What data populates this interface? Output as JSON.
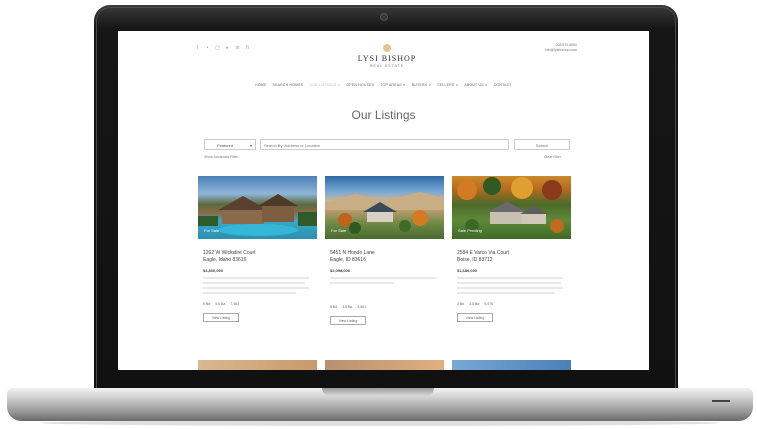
{
  "brand": {
    "name": "LYSI BISHOP",
    "tagline": "REAL ESTATE"
  },
  "contact": {
    "phone": "208.870.8000",
    "email": "info@lysibishop.com"
  },
  "social_icons": [
    "facebook-icon",
    "twitter-icon",
    "instagram-icon",
    "youtube-icon",
    "linkedin-icon",
    "houzz-icon"
  ],
  "nav": {
    "items": [
      {
        "label": "HOME"
      },
      {
        "label": "SEARCH HOMES"
      },
      {
        "label": "OUR LISTINGS ∨"
      },
      {
        "label": "OPEN HOUSES"
      },
      {
        "label": "TOP AREAS ∨"
      },
      {
        "label": "BUYERS ∨"
      },
      {
        "label": "SELLERS ∨"
      },
      {
        "label": "ABOUT US ∨"
      },
      {
        "label": "CONTACT"
      }
    ]
  },
  "page": {
    "title": "Our Listings"
  },
  "filter": {
    "sort_value": "Featured",
    "search_placeholder": "Search By: Address or Location",
    "search_button": "Search",
    "advanced_link": "Show Advanced Filter",
    "clear_link": "Clear Filter"
  },
  "listings": [
    {
      "status": "For Sale",
      "address_line1": "1262 W Wickstire Court",
      "address_line2": "Eagle, Idaho 83616",
      "price": "$3,800,000",
      "beds": "5 Bd",
      "baths": "5.5 Ba",
      "sqft": "7,463",
      "button": "View Listing"
    },
    {
      "status": "For Sale",
      "address_line1": "5451 N Hondo Lane",
      "address_line2": "Eagle, ID 83616",
      "price": "$2,098,000",
      "beds": "5 Bd",
      "baths": "3.5 Ba",
      "sqft": "3,961",
      "button": "View Listing"
    },
    {
      "status": "Sale Pending",
      "address_line1": "2584 E Varco Via Court",
      "address_line2": "Boise, ID 83712",
      "price": "$1,680,000",
      "beds": "4 Bd",
      "baths": "3.5 Ba",
      "sqft": "5,476",
      "button": "View Listing"
    }
  ],
  "colors": {
    "accent_gold": "#d9b777",
    "frame_dark": "#111111",
    "text_gray": "#555555"
  }
}
